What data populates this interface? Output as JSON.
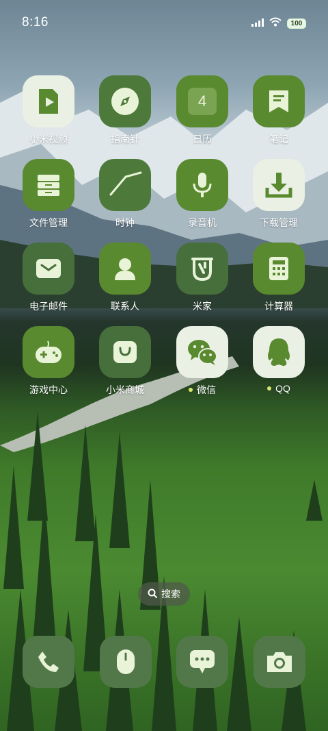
{
  "status_bar": {
    "time": "8:16",
    "battery": "100",
    "icons": [
      "signal-icon",
      "wifi-icon",
      "battery-icon"
    ]
  },
  "apps": [
    {
      "label": "小米视频",
      "icon": "video-icon"
    },
    {
      "label": "指南针",
      "icon": "compass-icon"
    },
    {
      "label": "日历",
      "icon": "calendar-icon",
      "badge": "4"
    },
    {
      "label": "笔记",
      "icon": "notes-icon"
    },
    {
      "label": "文件管理",
      "icon": "file-manager-icon"
    },
    {
      "label": "时钟",
      "icon": "clock-icon"
    },
    {
      "label": "录音机",
      "icon": "microphone-icon"
    },
    {
      "label": "下载管理",
      "icon": "download-icon"
    },
    {
      "label": "电子邮件",
      "icon": "email-icon"
    },
    {
      "label": "联系人",
      "icon": "contacts-icon"
    },
    {
      "label": "米家",
      "icon": "mijia-icon"
    },
    {
      "label": "计算器",
      "icon": "calculator-icon"
    },
    {
      "label": "游戏中心",
      "icon": "game-center-icon"
    },
    {
      "label": "小米商城",
      "icon": "mi-store-icon"
    },
    {
      "label": "微信",
      "icon": "wechat-icon",
      "notification_dot": true
    },
    {
      "label": "QQ",
      "icon": "qq-icon",
      "notification_dot": true
    }
  ],
  "search": {
    "label": "搜索",
    "icon": "search-icon"
  },
  "dock": [
    {
      "icon": "phone-icon"
    },
    {
      "icon": "browser-icon"
    },
    {
      "icon": "messages-icon"
    },
    {
      "icon": "camera-icon"
    }
  ],
  "colors": {
    "tile_green": "#5a8a2f",
    "tile_light": "#ebf0e4",
    "glyph_light": "#e9f3d8",
    "dock_tile": "#52784a"
  }
}
